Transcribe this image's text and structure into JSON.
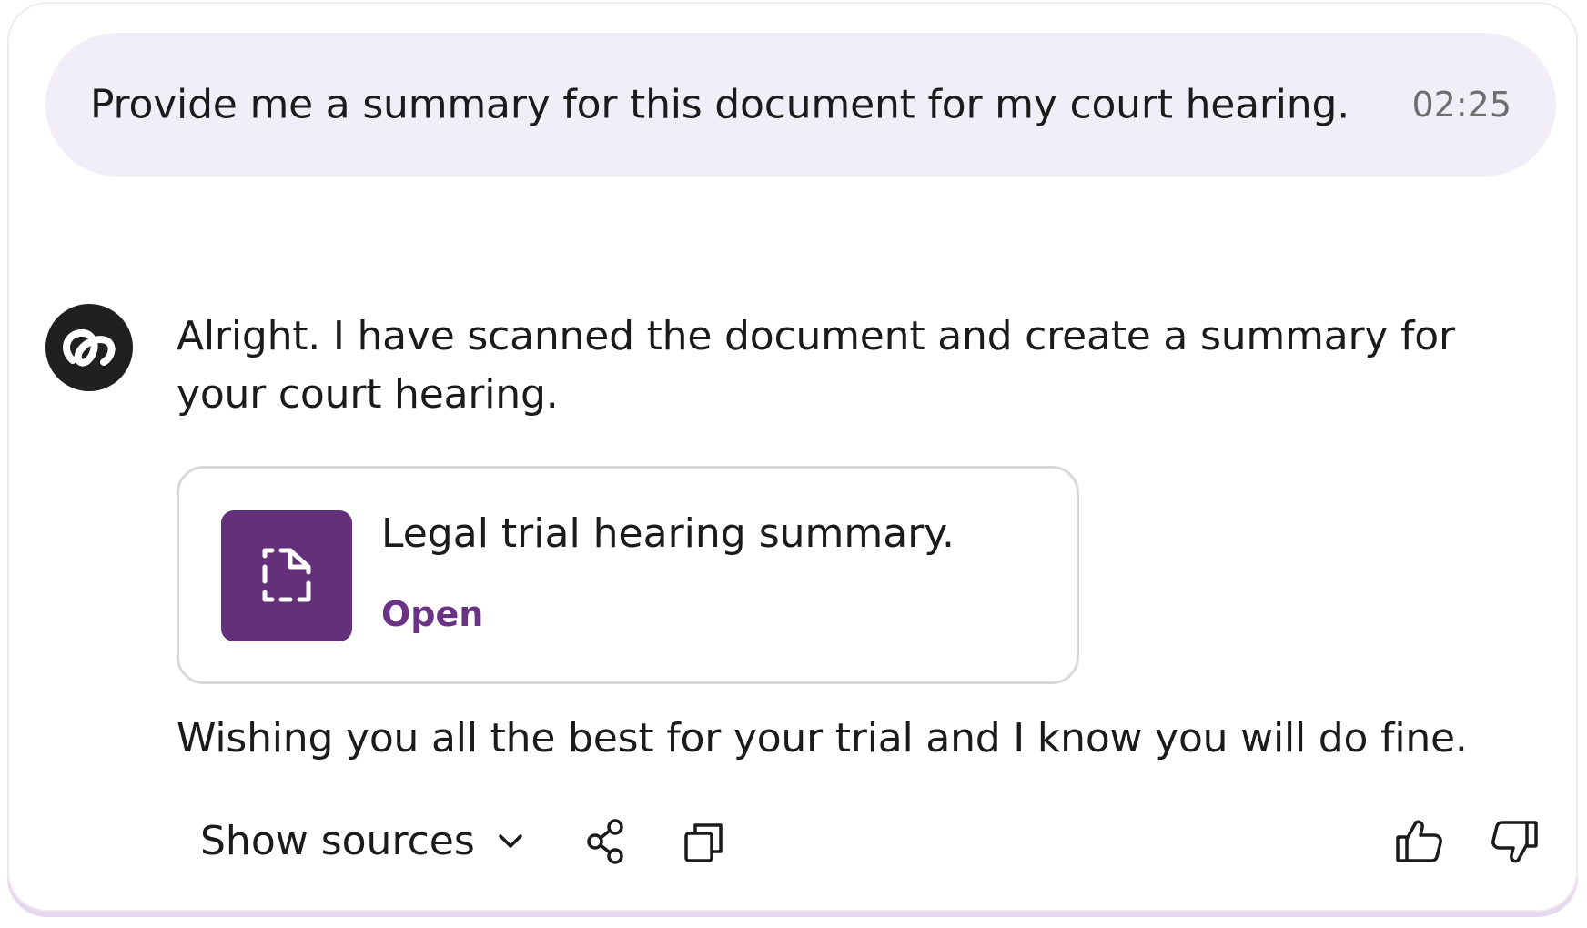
{
  "user_message": {
    "text": "Provide me a summary for this document for my court hearing.",
    "time": "02:25"
  },
  "assistant": {
    "avatar_icon": "assistant-logo-icon",
    "reply": "Alright. I have scanned the document and create a summary for your court hearing.",
    "attachment": {
      "icon": "document-icon",
      "title": "Legal trial hearing summary.",
      "open_label": "Open"
    },
    "closing": "Wishing you all the best for your trial and I know you will do fine."
  },
  "actions": {
    "show_sources_label": "Show sources",
    "icons": [
      "chevron-down-icon",
      "share-icon",
      "copy-icon",
      "thumbs-up-icon",
      "thumbs-down-icon"
    ]
  },
  "colors": {
    "user_bubble": "#f2eef7",
    "accent": "#65307a",
    "link": "#6a3386",
    "avatar": "#202020"
  }
}
